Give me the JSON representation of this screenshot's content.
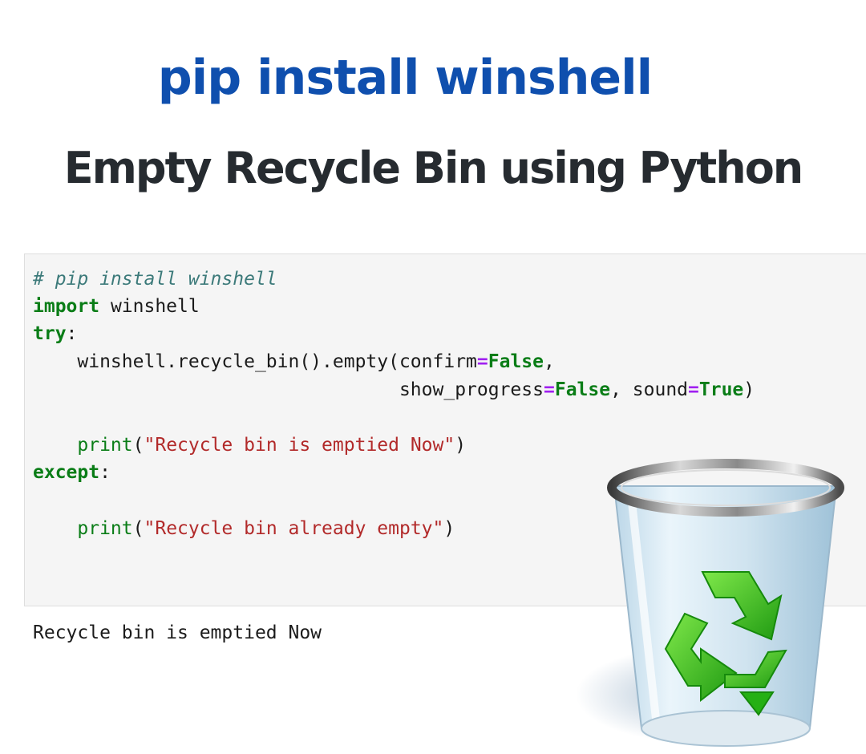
{
  "header": {
    "title": "pip install winshell",
    "subtitle": "Empty Recycle Bin using Python"
  },
  "code": {
    "comment": "# pip install winshell",
    "import_kw": "import",
    "import_mod": " winshell",
    "try_kw": "try",
    "colon": ":",
    "line4_call": "    winshell.recycle_bin().empty(confirm",
    "eq": "=",
    "false_val": "False",
    "comma": ",",
    "line5_indent": "                                 show_progress",
    "line5_mid": ", sound",
    "true_val": "True",
    "close_paren": ")",
    "indent": "    ",
    "print_fn": "print",
    "open_paren": "(",
    "str1": "\"Recycle bin is emptied Now\"",
    "except_kw": "except",
    "str2": "\"Recycle bin already empty\""
  },
  "output": {
    "text": "Recycle bin is emptied Now"
  },
  "colors": {
    "title_blue": "#0f4fae",
    "subtitle_dark": "#262b30",
    "keyword_green": "#0a7d17",
    "string_red": "#b22a2a",
    "operator_purple": "#a020f0",
    "recycle_green": "#35c21f"
  },
  "icons": [
    "recycle-bin-icon",
    "recycle-arrows-icon"
  ]
}
